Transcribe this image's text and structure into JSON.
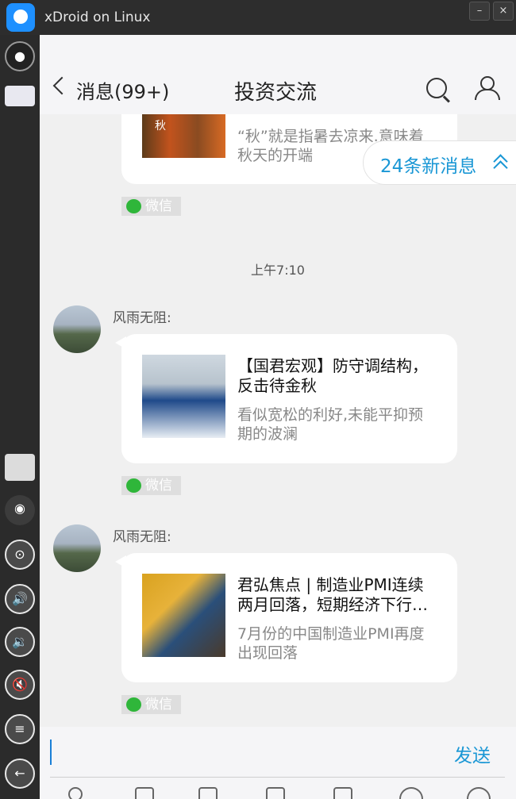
{
  "window": {
    "title": "xDroid on Linux",
    "minimize_label": "–",
    "close_label": "×"
  },
  "sidebar": {
    "items": [
      {
        "icon": "camera-lens-icon"
      },
      {
        "icon": "keyboard-icon"
      },
      {
        "icon": "keymap-icon"
      },
      {
        "icon": "webcam-icon"
      },
      {
        "icon": "location-icon"
      },
      {
        "icon": "volume-up-icon"
      },
      {
        "icon": "volume-down-icon"
      },
      {
        "icon": "mute-icon"
      },
      {
        "icon": "menu-icon"
      },
      {
        "icon": "back-icon"
      }
    ]
  },
  "chat": {
    "back_label": "消息(99+)",
    "title": "投资交流",
    "new_messages_label": "24条新消息",
    "time_label": "上午7:10",
    "wechat_tag": "微信",
    "messages": [
      {
        "sender": "",
        "title": "",
        "desc": "“秋”就是指暑去凉来.意味着秋天的开端",
        "thumb_text": "秋"
      },
      {
        "sender": "风雨无阻:",
        "title": "【国君宏观】防守调结构，反击待金秋",
        "desc": "看似宽松的利好,未能平抑预期的波澜"
      },
      {
        "sender": "风雨无阻:",
        "title": "君弘焦点 | 制造业PMI连续两月回落，短期经济下行…",
        "desc": "7月份的中国制造业PMI再度出现回落"
      }
    ],
    "input": {
      "value": "",
      "send_label": "发送"
    }
  }
}
